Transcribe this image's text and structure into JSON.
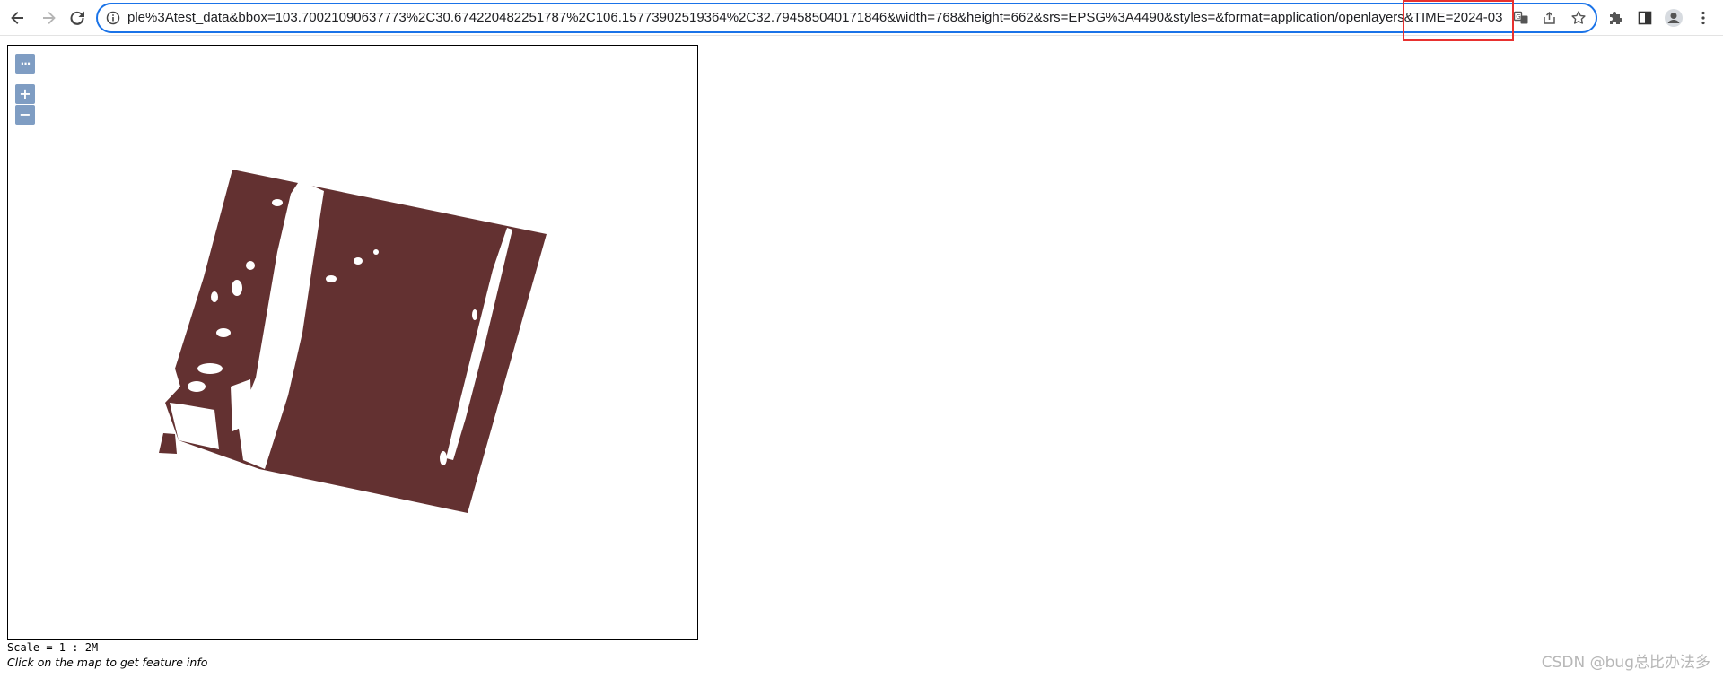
{
  "browser": {
    "url": "ple%3Atest_data&bbox=103.70021090637773%2C30.674220482251787%2C106.15773902519364%2C32.794585040171846&width=768&height=662&srs=EPSG%3A4490&styles=&format=application/openlayers&TIME=2024-03",
    "accent_color": "#1a73e8",
    "highlight_color": "#e8312f",
    "nav_icons": [
      "back-arrow-icon",
      "forward-arrow-icon",
      "reload-icon"
    ],
    "omnibox_icons": [
      "translate-icon",
      "share-icon",
      "bookmark-star-icon"
    ],
    "toolbar_icons": [
      "extensions-puzzle-icon",
      "side-panel-icon",
      "profile-avatar-icon",
      "more-menu-icon"
    ]
  },
  "map": {
    "toggle_label": "···",
    "zoom_in_label": "+",
    "zoom_out_label": "−",
    "raster_color": "#633131",
    "scale_text": "Scale = 1 : 2M",
    "click_info_text": "Click on the map to get feature info"
  },
  "watermark": {
    "text": "CSDN @bug总比办法多"
  }
}
